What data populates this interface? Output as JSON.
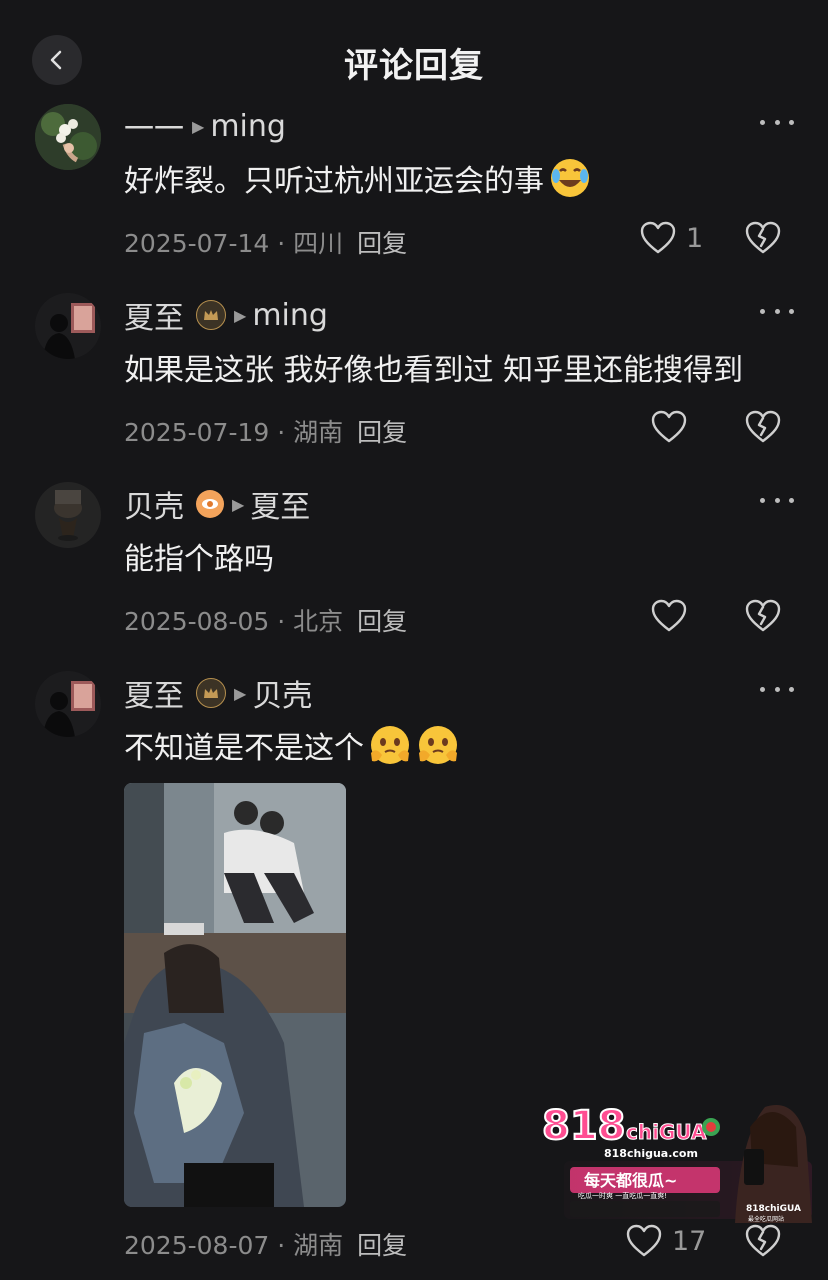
{
  "header": {
    "title": "评论回复",
    "back_icon": "chevron-left-icon"
  },
  "comments": [
    {
      "author": "一一",
      "reply_to": "ming",
      "badge": "",
      "text": "好炸裂。只听过杭州亚运会的事",
      "emoji": [
        "laugh-cry-emoji"
      ],
      "date": "2025-07-14",
      "location": "四川",
      "reply_label": "回复",
      "likes": "1"
    },
    {
      "author": "夏至",
      "reply_to": "ming",
      "badge": "crown-badge",
      "text": "如果是这张  我好像也看到过  知乎里还能搜得到",
      "emoji": [],
      "date": "2025-07-19",
      "location": "湖南",
      "reply_label": "回复",
      "likes": ""
    },
    {
      "author": "贝壳",
      "reply_to": "夏至",
      "badge": "eye-badge",
      "text": "能指个路吗",
      "emoji": [],
      "date": "2025-08-05",
      "location": "北京",
      "reply_label": "回复",
      "likes": ""
    },
    {
      "author": "夏至",
      "reply_to": "贝壳",
      "badge": "crown-badge",
      "text": "不知道是不是这个",
      "emoji": [
        "holding-tears-emoji",
        "holding-tears-emoji"
      ],
      "date": "2025-08-07",
      "location": "湖南",
      "reply_label": "回复",
      "likes": "17"
    }
  ],
  "separator": " · ",
  "ad": {
    "brand_main": "818",
    "brand_sub": "chiGUA",
    "url": "818chigua.com",
    "slogan": "每天都很瓜~",
    "tagline": "吃瓜一时爽 一直吃瓜一直爽!",
    "corner_brand": "818chiGUA",
    "corner_text": "最全吃瓜网站"
  },
  "colors": {
    "background": "#161618",
    "text": "#f0f0f0",
    "meta": "#8c8c8c",
    "ad_pink": "#e0397a"
  }
}
